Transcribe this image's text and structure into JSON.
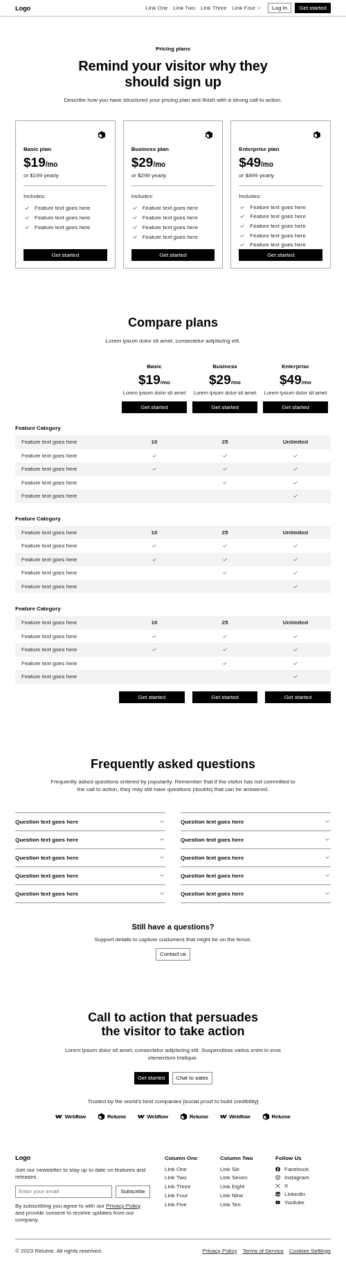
{
  "nav": {
    "logo": "Logo",
    "links": [
      {
        "label": "Link One",
        "dropdown": false
      },
      {
        "label": "Link Two",
        "dropdown": false
      },
      {
        "label": "Link Three",
        "dropdown": false
      },
      {
        "label": "Link Four",
        "dropdown": true
      }
    ],
    "login": "Log in",
    "cta": "Get started"
  },
  "hero": {
    "tagline": "Pricing plans",
    "title": "Remind your visitor why they should sign up",
    "description": "Describe how you have structured your pricing plan and finish with a strong call to action."
  },
  "plans": [
    {
      "name": "Basic plan",
      "price": "$19",
      "period": "/mo",
      "yearly": "or $199 yearly",
      "includes": "Includes:",
      "features": [
        "Feature text goes here",
        "Feature text goes here",
        "Feature text goes here"
      ],
      "button": "Get started"
    },
    {
      "name": "Business plan",
      "price": "$29",
      "period": "/mo",
      "yearly": "or $299 yearly",
      "includes": "Includes:",
      "features": [
        "Feature text goes here",
        "Feature text goes here",
        "Feature text goes here",
        "Feature text goes here"
      ],
      "button": "Get started"
    },
    {
      "name": "Enterprise plan",
      "price": "$49",
      "period": "/mo",
      "yearly": "or $499 yearly",
      "includes": "Includes:",
      "features": [
        "Feature text goes here",
        "Feature text goes here",
        "Feature text goes here",
        "Feature text goes here",
        "Feature text goes here"
      ],
      "button": "Get started"
    }
  ],
  "compare": {
    "title": "Compare plans",
    "subtitle": "Lorem ipsum dolor sit amet, consectetur adipiscing elit.",
    "columns": [
      {
        "name": "Basic",
        "price": "$19",
        "period": "/mo",
        "description": "Lorem ipsum dolor sit amet",
        "button": "Get started"
      },
      {
        "name": "Business",
        "price": "$29",
        "period": "/mo",
        "description": "Lorem ipsum dolor sit amet",
        "button": "Get started"
      },
      {
        "name": "Enterprise",
        "price": "$49",
        "period": "/mo",
        "description": "Lorem ipsum dolor sit amet",
        "button": "Get started"
      }
    ],
    "categories": [
      {
        "title": "Feature Category",
        "rows": [
          {
            "feature": "Feature text goes here",
            "cells": [
              {
                "kind": "text",
                "text": "10"
              },
              {
                "kind": "text",
                "text": "25"
              },
              {
                "kind": "text",
                "text": "Unlimited"
              }
            ]
          },
          {
            "feature": "Feature text goes here",
            "cells": [
              {
                "kind": "check",
                "checked": true
              },
              {
                "kind": "check",
                "checked": true
              },
              {
                "kind": "check",
                "checked": true
              }
            ]
          },
          {
            "feature": "Feature text goes here",
            "cells": [
              {
                "kind": "check",
                "checked": true
              },
              {
                "kind": "check",
                "checked": true
              },
              {
                "kind": "check",
                "checked": true
              }
            ]
          },
          {
            "feature": "Feature text goes here",
            "cells": [
              {
                "kind": "check",
                "checked": false
              },
              {
                "kind": "check",
                "checked": true
              },
              {
                "kind": "check",
                "checked": true
              }
            ]
          },
          {
            "feature": "Feature text goes here",
            "cells": [
              {
                "kind": "check",
                "checked": false
              },
              {
                "kind": "check",
                "checked": false
              },
              {
                "kind": "check",
                "checked": true
              }
            ]
          }
        ]
      },
      {
        "title": "Feature Category",
        "rows": [
          {
            "feature": "Feature text goes here",
            "cells": [
              {
                "kind": "text",
                "text": "10"
              },
              {
                "kind": "text",
                "text": "25"
              },
              {
                "kind": "text",
                "text": "Unlimited"
              }
            ]
          },
          {
            "feature": "Feature text goes here",
            "cells": [
              {
                "kind": "check",
                "checked": true
              },
              {
                "kind": "check",
                "checked": true
              },
              {
                "kind": "check",
                "checked": true
              }
            ]
          },
          {
            "feature": "Feature text goes here",
            "cells": [
              {
                "kind": "check",
                "checked": true
              },
              {
                "kind": "check",
                "checked": true
              },
              {
                "kind": "check",
                "checked": true
              }
            ]
          },
          {
            "feature": "Feature text goes here",
            "cells": [
              {
                "kind": "check",
                "checked": false
              },
              {
                "kind": "check",
                "checked": true
              },
              {
                "kind": "check",
                "checked": true
              }
            ]
          },
          {
            "feature": "Feature text goes here",
            "cells": [
              {
                "kind": "check",
                "checked": false
              },
              {
                "kind": "check",
                "checked": false
              },
              {
                "kind": "check",
                "checked": true
              }
            ]
          }
        ]
      },
      {
        "title": "Feature Category",
        "rows": [
          {
            "feature": "Feature text goes here",
            "cells": [
              {
                "kind": "text",
                "text": "10"
              },
              {
                "kind": "text",
                "text": "25"
              },
              {
                "kind": "text",
                "text": "Unlimited"
              }
            ]
          },
          {
            "feature": "Feature text goes here",
            "cells": [
              {
                "kind": "check",
                "checked": true
              },
              {
                "kind": "check",
                "checked": true
              },
              {
                "kind": "check",
                "checked": true
              }
            ]
          },
          {
            "feature": "Feature text goes here",
            "cells": [
              {
                "kind": "check",
                "checked": true
              },
              {
                "kind": "check",
                "checked": true
              },
              {
                "kind": "check",
                "checked": true
              }
            ]
          },
          {
            "feature": "Feature text goes here",
            "cells": [
              {
                "kind": "check",
                "checked": false
              },
              {
                "kind": "check",
                "checked": true
              },
              {
                "kind": "check",
                "checked": true
              }
            ]
          },
          {
            "feature": "Feature text goes here",
            "cells": [
              {
                "kind": "check",
                "checked": false
              },
              {
                "kind": "check",
                "checked": false
              },
              {
                "kind": "check",
                "checked": true
              }
            ]
          }
        ]
      }
    ],
    "bottom_buttons": [
      "Get started",
      "Get started",
      "Get started"
    ]
  },
  "faq": {
    "title": "Frequently asked questions",
    "description": "Frequently asked questions ordered by popularity. Remember that if the visitor has not committed to the call to action, they may still have questions (doubts) that can be answered.",
    "columns": [
      [
        "Question text goes here",
        "Question text goes here",
        "Question text goes here",
        "Question text goes here",
        "Question text goes here"
      ],
      [
        "Question text goes here",
        "Question text goes here",
        "Question text goes here",
        "Question text goes here",
        "Question text goes here"
      ]
    ],
    "contact_title": "Still have a questions?",
    "contact_text": "Support details to capture customers that might be on the fence.",
    "contact_button": "Contact us"
  },
  "cta": {
    "title": "Call to action that persuades the visitor to take action",
    "description": "Lorem ipsum dolor sit amet, consectetur adipiscing elit. Suspendisse varius enim in eros elementum tristique.",
    "buttons": [
      {
        "label": "Get started",
        "kind": "primary"
      },
      {
        "label": "Chat to sales",
        "kind": "secondary"
      }
    ],
    "trusted": "Trusted by the world's best companies [social proof to build credibility]",
    "logos": [
      {
        "name": "Webflow",
        "kind": "webflow"
      },
      {
        "name": "Relume",
        "kind": "relume"
      },
      {
        "name": "Webflow",
        "kind": "webflow"
      },
      {
        "name": "Relume",
        "kind": "relume"
      },
      {
        "name": "Webflow",
        "kind": "webflow"
      },
      {
        "name": "Relume",
        "kind": "relume"
      }
    ]
  },
  "footer": {
    "logo": "Logo",
    "newsletter": "Join our newsletter to stay up to date on features and releases.",
    "email_placeholder": "Enter your email",
    "subscribe": "Subscribe",
    "consent_before": "By subscribing you agree to with our",
    "consent_link": "Privacy Policy",
    "consent_after": "and provide consent to receive updates from our company.",
    "columns": [
      {
        "title": "Column One",
        "links": [
          "Link One",
          "Link Two",
          "Link Three",
          "Link Four",
          "Link Five"
        ]
      },
      {
        "title": "Column Two",
        "links": [
          "Link Six",
          "Link Seven",
          "Link Eight",
          "Link Nine",
          "Link Ten"
        ]
      }
    ],
    "social_title": "Follow Us",
    "social": [
      {
        "label": "Facebook",
        "kind": "facebook"
      },
      {
        "label": "Instagram",
        "kind": "instagram"
      },
      {
        "label": "X",
        "kind": "x"
      },
      {
        "label": "LinkedIn",
        "kind": "linkedin"
      },
      {
        "label": "Youtube",
        "kind": "youtube"
      }
    ],
    "copyright": "© 2023 Relume. All rights reserved.",
    "legal": [
      "Privacy Policy",
      "Terms of Service",
      "Cookies Settings"
    ]
  }
}
